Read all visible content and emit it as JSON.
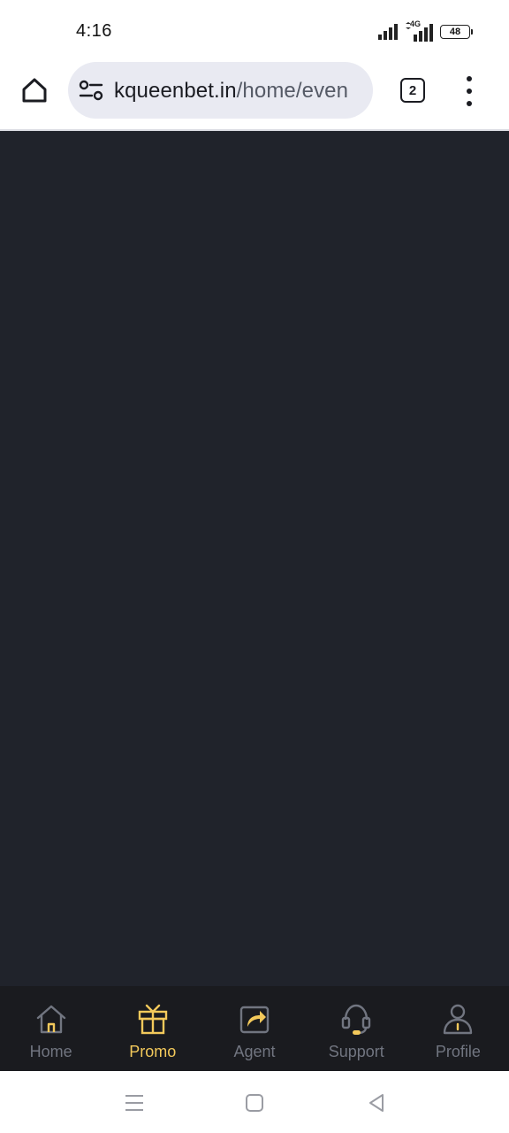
{
  "status_bar": {
    "time": "4:16",
    "network_label": "4G",
    "battery_level": "48",
    "icons": [
      "signal-icon",
      "signal-4g-icon",
      "battery-icon"
    ]
  },
  "browser": {
    "url_domain": "kqueenbet.in",
    "url_path": "/home/even",
    "tab_count": "2",
    "icons": [
      "home-icon",
      "site-settings-icon",
      "tab-switcher-icon",
      "more-menu-icon"
    ]
  },
  "content": {
    "background": "#20232b"
  },
  "bottom_nav": {
    "active_color": "#f3c95b",
    "inactive_color": "#717580",
    "items": [
      {
        "label": "Home",
        "icon": "house-icon",
        "active": false
      },
      {
        "label": "Promo",
        "icon": "gift-icon",
        "active": true
      },
      {
        "label": "Agent",
        "icon": "share-icon",
        "active": false
      },
      {
        "label": "Support",
        "icon": "headset-icon",
        "active": false
      },
      {
        "label": "Profile",
        "icon": "person-icon",
        "active": false
      }
    ]
  },
  "system_nav": {
    "icons": [
      "recents-icon",
      "home-square-icon",
      "back-triangle-icon"
    ]
  }
}
